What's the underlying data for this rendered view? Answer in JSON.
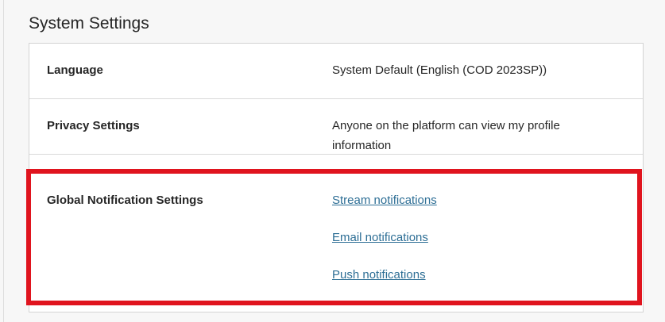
{
  "section": {
    "title": "System Settings"
  },
  "settings": {
    "language": {
      "label": "Language",
      "value": "System Default (English (COD 2023SP))"
    },
    "privacy": {
      "label": "Privacy Settings",
      "value": "Anyone on the platform can view my profile information"
    },
    "global_notifications": {
      "label": "Global Notification Settings",
      "links": {
        "stream": "Stream notifications",
        "email": "Email notifications",
        "push": "Push notifications"
      }
    }
  },
  "colors": {
    "link": "#2d6e95",
    "highlight": "#e0141e",
    "text": "#262626"
  }
}
